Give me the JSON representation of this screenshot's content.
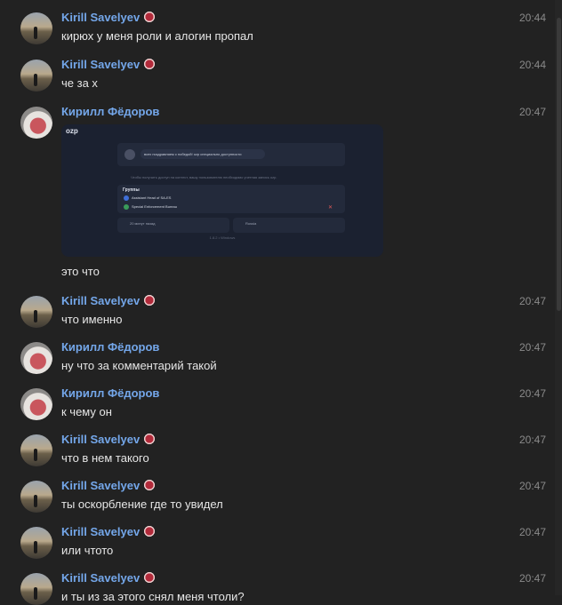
{
  "messages": [
    {
      "author": "Kirill Savelyev",
      "avatar": "sunset",
      "badge": true,
      "time": "20:44",
      "text": "кирюх у меня роли и алогин пропал"
    },
    {
      "author": "Kirill Savelyev",
      "avatar": "sunset",
      "badge": true,
      "time": "20:44",
      "text": "че за х"
    },
    {
      "author": "Кирилл Фёдоров",
      "avatar": "cat",
      "badge": false,
      "time": "20:47",
      "text": "это что"
    },
    {
      "author": "Kirill Savelyev",
      "avatar": "sunset",
      "badge": true,
      "time": "20:47",
      "text": "что именно"
    },
    {
      "author": "Кирилл Фёдоров",
      "avatar": "cat",
      "badge": false,
      "time": "20:47",
      "text": "ну что за комментарий такой"
    },
    {
      "author": "Кирилл Фёдоров",
      "avatar": "cat",
      "badge": false,
      "time": "20:47",
      "text": "к чему он"
    },
    {
      "author": "Kirill Savelyev",
      "avatar": "sunset",
      "badge": true,
      "time": "20:47",
      "text": "что в нем такого"
    },
    {
      "author": "Kirill Savelyev",
      "avatar": "sunset",
      "badge": true,
      "time": "20:47",
      "text": "ты оскорбление где то увидел"
    },
    {
      "author": "Kirill Savelyev",
      "avatar": "sunset",
      "badge": true,
      "time": "20:47",
      "text": "или чтото"
    },
    {
      "author": "Kirill Savelyev",
      "avatar": "sunset",
      "badge": true,
      "time": "20:47",
      "text": "и ты из за этого снял меня чтоли?"
    }
  ],
  "attachment": {
    "title": "ozp",
    "status": "всех поздравляем с победой! ozp специально доступности",
    "hint": "Чтобы получить доступ на контест, вашу пользователю необходимо учетная запись ozp.",
    "groups_label": "Группы",
    "roles": [
      "Assistant Head of SA-ES",
      "Special Enforcement Bureau"
    ],
    "card_left": "20 минут назад",
    "card_right": "Russia",
    "footer": "1.8.2 • Windows"
  },
  "colors": {
    "background": "#222222",
    "author": "#74a7ea",
    "time": "#8a8a8a",
    "text": "#e6e6e6"
  }
}
